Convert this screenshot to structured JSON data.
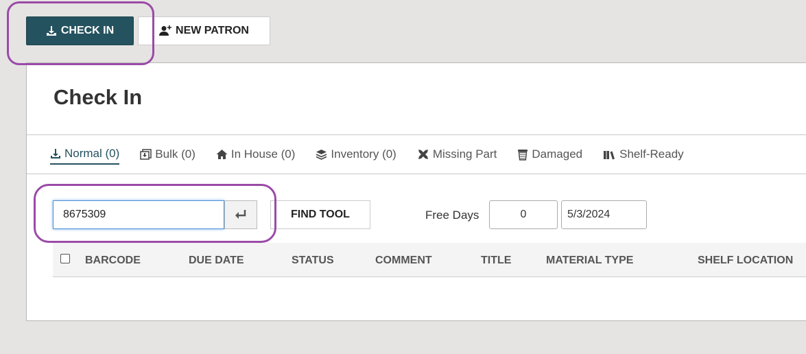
{
  "toolbar": {
    "check_in_label": "CHECK IN",
    "check_in_icon": "download-icon",
    "new_patron_label": "NEW PATRON",
    "new_patron_icon": "user-plus-icon"
  },
  "page": {
    "title": "Check In"
  },
  "tabs": [
    {
      "label": "Normal (0)",
      "icon": "download-icon",
      "active": true
    },
    {
      "label": "Bulk (0)",
      "icon": "bulk-icon"
    },
    {
      "label": "In House (0)",
      "icon": "home-icon"
    },
    {
      "label": "Inventory (0)",
      "icon": "layers-icon"
    },
    {
      "label": "Missing Part",
      "icon": "puzzle-icon"
    },
    {
      "label": "Damaged",
      "icon": "trash-icon"
    },
    {
      "label": "Shelf-Ready",
      "icon": "books-icon"
    }
  ],
  "scan": {
    "barcode_value": "8675309",
    "find_tool_label": "FIND TOOL",
    "free_days_label": "Free Days",
    "free_days_value": "0",
    "date_value": "5/3/2024"
  },
  "table": {
    "columns": [
      "BARCODE",
      "DUE DATE",
      "STATUS",
      "COMMENT",
      "TITLE",
      "MATERIAL TYPE",
      "SHELF LOCATION"
    ]
  },
  "colors": {
    "primary": "#25525f",
    "highlight": "#9b4aa8",
    "focus": "#4a90d9"
  }
}
